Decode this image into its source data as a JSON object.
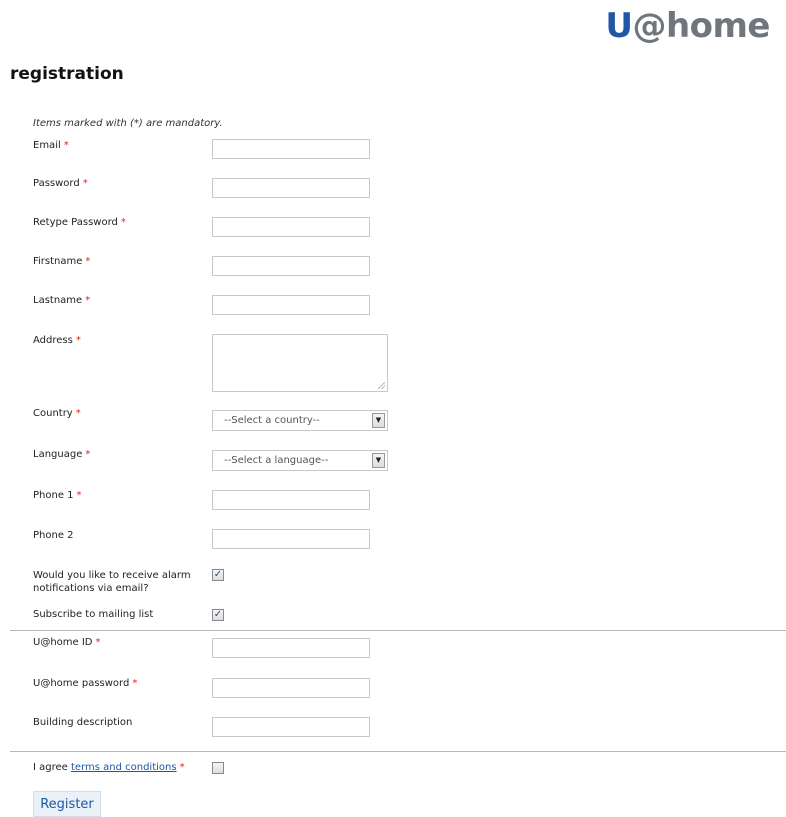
{
  "brand": {
    "logo_u": "U",
    "logo_rest": "@home"
  },
  "page": {
    "title": "registration",
    "mandatory_note": "Items marked with (*) are mandatory."
  },
  "required_mark": "*",
  "fields": {
    "email": {
      "label": "Email",
      "value": ""
    },
    "password": {
      "label": "Password",
      "value": ""
    },
    "retype_password": {
      "label": "Retype Password",
      "value": ""
    },
    "firstname": {
      "label": "Firstname",
      "value": ""
    },
    "lastname": {
      "label": "Lastname",
      "value": ""
    },
    "address": {
      "label": "Address",
      "value": ""
    },
    "country": {
      "label": "Country",
      "selected": "--Select a country--"
    },
    "language": {
      "label": "Language",
      "selected": "--Select a language--"
    },
    "phone1": {
      "label": "Phone 1",
      "value": ""
    },
    "phone2": {
      "label": "Phone 2",
      "value": ""
    },
    "alarm": {
      "label_line1": "Would you like to receive alarm",
      "label_line2": "notifications via email?",
      "checked": true
    },
    "mailing": {
      "label": "Subscribe to mailing list",
      "checked": true
    },
    "uhome_id": {
      "label": "U@home ID",
      "value": ""
    },
    "uhome_password": {
      "label": "U@home password",
      "value": ""
    },
    "building": {
      "label": "Building description",
      "value": ""
    },
    "agree": {
      "label_prefix": "I agree",
      "link_text": "terms and conditions",
      "checked": false
    }
  },
  "actions": {
    "register": "Register"
  },
  "checkmark": "✓",
  "dropdown_arrow": "▼"
}
